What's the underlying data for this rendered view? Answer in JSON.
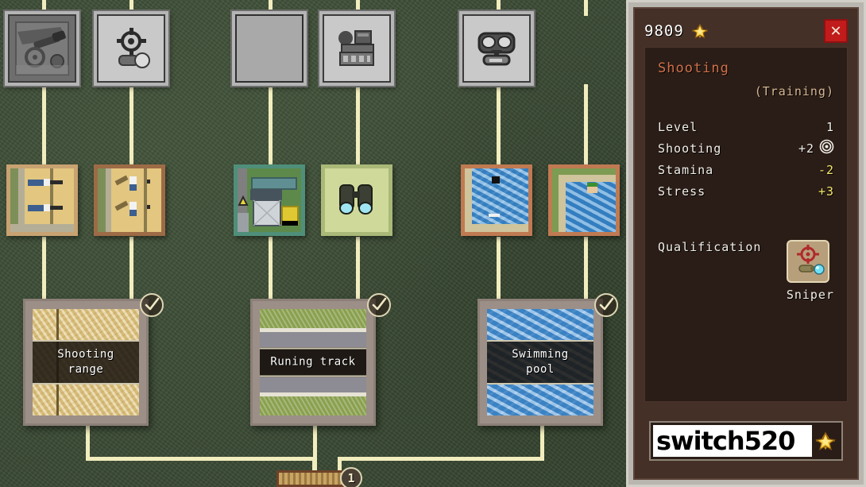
{
  "panel": {
    "currency_amount": "9809",
    "currency_icon": "gold-star-icon",
    "close_label": "✕",
    "skill_title": "Shooting",
    "skill_subtitle": "(Training)",
    "stats": [
      {
        "label": "Level",
        "value": "1",
        "icon": "",
        "highlight": false
      },
      {
        "label": "Shooting",
        "value": "+2",
        "icon": "target-icon",
        "highlight": false
      },
      {
        "label": "Stamina",
        "value": "-2",
        "icon": "",
        "highlight": true
      },
      {
        "label": "Stress",
        "value": "+3",
        "icon": "",
        "highlight": true
      }
    ],
    "qualification_label": "Qualification",
    "qualification_name": "Sniper",
    "qualification_icon": "sniper-scope-icon",
    "watermark_text": "switch520",
    "watermark_icon": "gold-star-icon"
  },
  "toolbar": {
    "tiles": [
      {
        "name": "cannon-tile",
        "icon": "cannon-icon",
        "state": "dark"
      },
      {
        "name": "crosshair-tile",
        "icon": "crosshair-scope-icon",
        "state": "normal"
      },
      {
        "name": "empty-tile",
        "icon": "blank-icon",
        "state": "blank"
      },
      {
        "name": "machinery-tile",
        "icon": "machinery-icon",
        "state": "normal"
      },
      {
        "name": "gasmask-tile",
        "icon": "gas-mask-icon",
        "state": "normal"
      }
    ]
  },
  "thumbnails": [
    {
      "name": "shooting-lane-prone-thumb",
      "icon": "prone-shooters-icon",
      "frame": "#c8a271"
    },
    {
      "name": "shooting-lane-throw-thumb",
      "icon": "standing-throwers-icon",
      "frame": "#9d6b46"
    },
    {
      "name": "equipment-shed-thumb",
      "icon": "shed-icon",
      "frame": "#4f8f7a"
    },
    {
      "name": "binoculars-thumb",
      "icon": "binoculars-icon",
      "frame": "#aab878"
    },
    {
      "name": "pool-lane-thumb",
      "icon": "pool-swimmer-icon",
      "frame": "#c07a52"
    },
    {
      "name": "pool-deck-thumb",
      "icon": "pool-deck-icon",
      "frame": "#c07a52"
    }
  ],
  "facilities": [
    {
      "name": "shooting-range",
      "label": "Shooting\nrange",
      "line1": "Shooting",
      "line2": "range",
      "surface": "sand",
      "completed": true
    },
    {
      "name": "running-track",
      "label": "Runing track",
      "line1": "Runing track",
      "line2": "",
      "surface": "track",
      "completed": true
    },
    {
      "name": "swimming-pool",
      "label": "Swimming\npool",
      "line1": "Swimming",
      "line2": "pool",
      "surface": "water",
      "completed": true
    }
  ],
  "network": {
    "hub_badge": "1"
  },
  "colors": {
    "terrain": "#3a4a34",
    "wire": "#f2edbe",
    "panel_frame": "#b9b6b0",
    "panel_body": "#453027",
    "info_box": "#2a1d17",
    "skill_accent": "#d2714a",
    "warn": "#f3e96a",
    "close": "#c11b1b"
  }
}
